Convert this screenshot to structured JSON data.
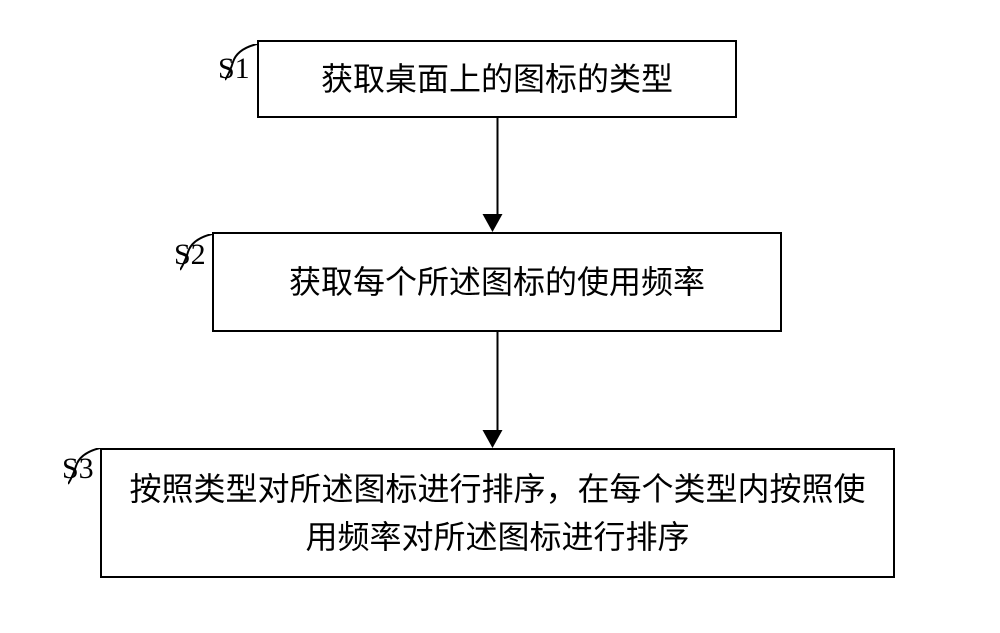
{
  "chart_data": {
    "type": "flowchart",
    "steps": [
      {
        "id": "S1",
        "label": "S1",
        "text": "获取桌面上的图标的类型"
      },
      {
        "id": "S2",
        "label": "S2",
        "text": "获取每个所述图标的使用频率"
      },
      {
        "id": "S3",
        "label": "S3",
        "text": "按照类型对所述图标进行排序，在每个类型内按照使用频率对所述图标进行排序"
      }
    ],
    "connections": [
      {
        "from": "S1",
        "to": "S2"
      },
      {
        "from": "S2",
        "to": "S3"
      }
    ]
  }
}
